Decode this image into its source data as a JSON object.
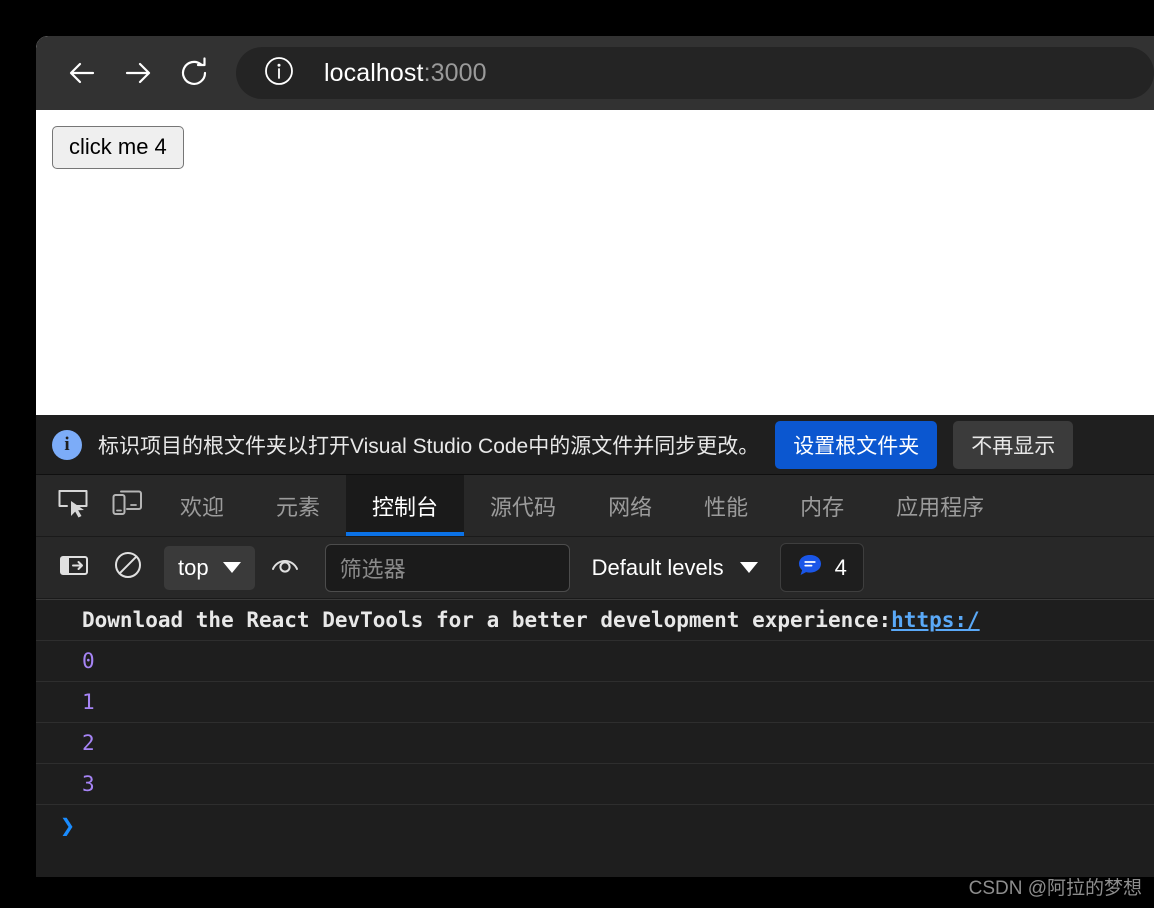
{
  "browser": {
    "nav": {
      "back_label": "Back",
      "forward_label": "Forward",
      "reload_label": "Reload"
    },
    "omnibox": {
      "site_info_icon": "info-circle-icon",
      "url_host": "localhost",
      "url_port": ":3000"
    }
  },
  "page": {
    "button_label": "click me 4"
  },
  "devtools": {
    "infobar": {
      "icon": "info-icon",
      "icon_glyph": "i",
      "message": "标识项目的根文件夹以打开Visual Studio Code中的源文件并同步更改。",
      "primary_button": "设置根文件夹",
      "secondary_button": "不再显示",
      "primary_color": "#0b57d0"
    },
    "tabstrip": {
      "inspect_icon": "inspect-element-icon",
      "device_icon": "device-toolbar-icon",
      "tabs": [
        {
          "label": "欢迎",
          "active": false
        },
        {
          "label": "元素",
          "active": false
        },
        {
          "label": "控制台",
          "active": true
        },
        {
          "label": "源代码",
          "active": false
        },
        {
          "label": "网络",
          "active": false
        },
        {
          "label": "性能",
          "active": false
        },
        {
          "label": "内存",
          "active": false
        },
        {
          "label": "应用程序",
          "active": false
        }
      ],
      "active_underline_color": "#0b72e7"
    },
    "console_toolbar": {
      "sidebar_icon": "show-console-sidebar-icon",
      "clear_icon": "clear-console-icon",
      "context": "top",
      "eye_icon": "create-live-expression-icon",
      "filter_placeholder": "筛选器",
      "filter_value": "",
      "levels_label": "Default levels",
      "message_icon": "message-bubble-icon",
      "message_count": "4",
      "message_icon_color": "#1a56e8"
    },
    "console_rows": [
      {
        "kind": "message",
        "text": "Download the React DevTools for a better development experience: ",
        "link": "https:/"
      },
      {
        "kind": "value",
        "text": "0"
      },
      {
        "kind": "value",
        "text": "1"
      },
      {
        "kind": "value",
        "text": "2"
      },
      {
        "kind": "value",
        "text": "3"
      }
    ],
    "prompt_glyph": "❯"
  },
  "watermark": {
    "text": "CSDN @阿拉的梦想"
  }
}
